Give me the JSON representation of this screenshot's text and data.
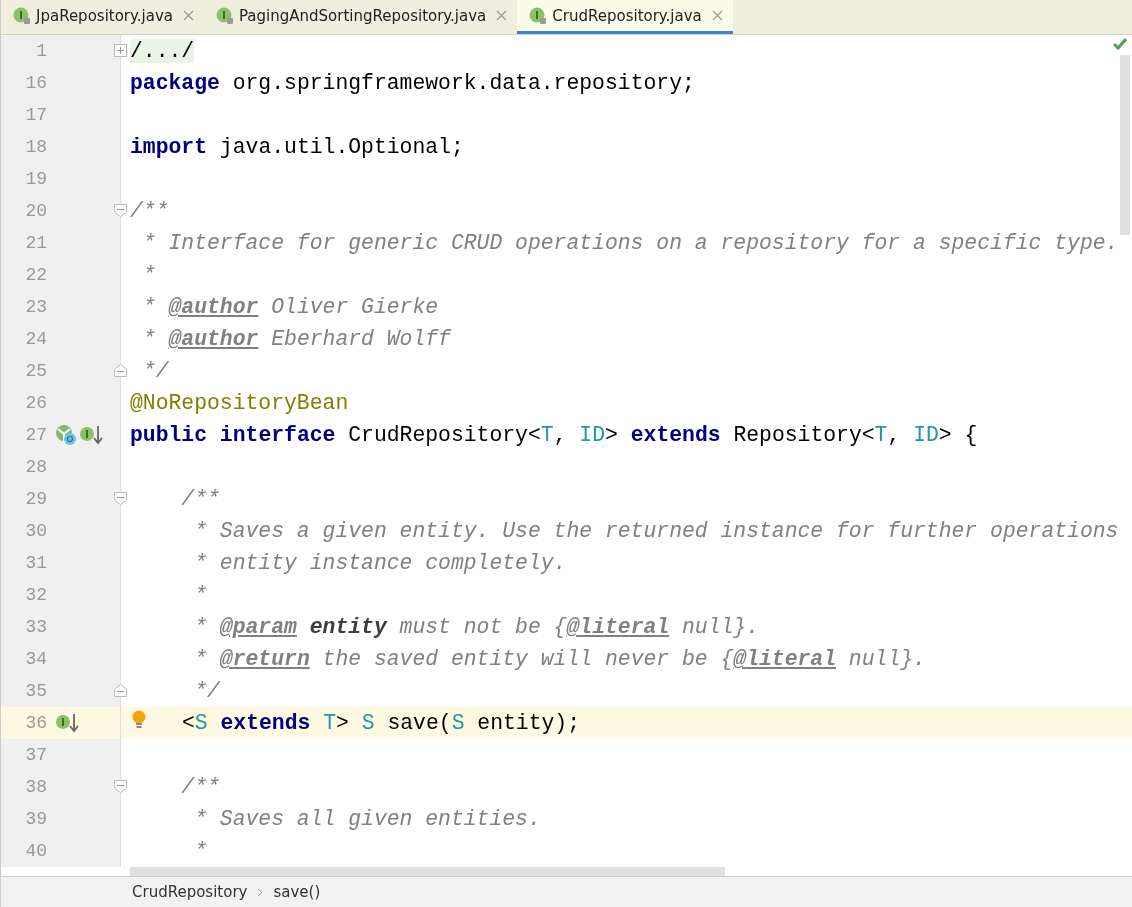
{
  "tabs": [
    {
      "label": "JpaRepository.java",
      "selected": false
    },
    {
      "label": "PagingAndSortingRepository.java",
      "selected": false
    },
    {
      "label": "CrudRepository.java",
      "selected": true
    }
  ],
  "lines": [
    {
      "number": "1",
      "current": false,
      "intention": false,
      "fold": {
        "kind": "expand"
      },
      "tokens": [
        {
          "kind": "folded",
          "text": "/.../"
        }
      ]
    },
    {
      "number": "16",
      "current": false,
      "intention": false,
      "tokens": [
        {
          "kind": "keyword",
          "text": "package"
        },
        {
          "kind": "plain",
          "text": " org.springframework.data.repository;"
        }
      ]
    },
    {
      "number": "17",
      "current": false,
      "intention": false
    },
    {
      "number": "18",
      "current": false,
      "intention": false,
      "tokens": [
        {
          "kind": "keyword",
          "text": "import"
        },
        {
          "kind": "plain",
          "text": " java.util.Optional;"
        }
      ]
    },
    {
      "number": "19",
      "current": false,
      "intention": false
    },
    {
      "number": "20",
      "current": false,
      "intention": false,
      "fold": {
        "kind": "start"
      },
      "tokens": [
        {
          "kind": "doc",
          "text": "/**"
        }
      ]
    },
    {
      "number": "21",
      "current": false,
      "intention": false,
      "tokens": [
        {
          "kind": "doc",
          "text": " * Interface for generic CRUD operations on a repository for a specific type."
        }
      ]
    },
    {
      "number": "22",
      "current": false,
      "intention": false,
      "tokens": [
        {
          "kind": "doc",
          "text": " *"
        }
      ]
    },
    {
      "number": "23",
      "current": false,
      "intention": false,
      "tokens": [
        {
          "kind": "doc",
          "text": " * "
        },
        {
          "kind": "doctag",
          "text": "@author"
        },
        {
          "kind": "doc",
          "text": " Oliver Gierke"
        }
      ]
    },
    {
      "number": "24",
      "current": false,
      "intention": false,
      "tokens": [
        {
          "kind": "doc",
          "text": " * "
        },
        {
          "kind": "doctag",
          "text": "@author"
        },
        {
          "kind": "doc",
          "text": " Eberhard Wolff"
        }
      ]
    },
    {
      "number": "25",
      "current": false,
      "intention": false,
      "fold": {
        "kind": "end"
      },
      "tokens": [
        {
          "kind": "doc",
          "text": " */"
        }
      ]
    },
    {
      "number": "26",
      "current": false,
      "intention": false,
      "tokens": [
        {
          "kind": "annotation",
          "text": "@NoRepositoryBean"
        }
      ]
    },
    {
      "number": "27",
      "current": false,
      "intention": false,
      "markers": [
        {
          "kind": "inheritors"
        },
        {
          "kind": "implements"
        }
      ],
      "tokens": [
        {
          "kind": "keyword",
          "text": "public"
        },
        {
          "kind": "keyword",
          "text": " interface"
        },
        {
          "kind": "plain",
          "text": " CrudRepository<"
        },
        {
          "kind": "typeparam",
          "text": "T"
        },
        {
          "kind": "plain",
          "text": ", "
        },
        {
          "kind": "typeparam",
          "text": "ID"
        },
        {
          "kind": "plain",
          "text": "> "
        },
        {
          "kind": "keyword",
          "text": "extends"
        },
        {
          "kind": "plain",
          "text": " Repository<"
        },
        {
          "kind": "typeparam",
          "text": "T"
        },
        {
          "kind": "plain",
          "text": ", "
        },
        {
          "kind": "typeparam",
          "text": "ID"
        },
        {
          "kind": "plain",
          "text": "> {"
        }
      ]
    },
    {
      "number": "28",
      "current": false,
      "intention": false
    },
    {
      "number": "29",
      "current": false,
      "intention": false,
      "fold": {
        "kind": "start"
      },
      "tokens": [
        {
          "kind": "doc",
          "text": "    /**"
        }
      ]
    },
    {
      "number": "30",
      "current": false,
      "intention": false,
      "tokens": [
        {
          "kind": "doc",
          "text": "     * Saves a given entity. Use the returned instance for further operations"
        }
      ]
    },
    {
      "number": "31",
      "current": false,
      "intention": false,
      "tokens": [
        {
          "kind": "doc",
          "text": "     * entity instance completely."
        }
      ]
    },
    {
      "number": "32",
      "current": false,
      "intention": false,
      "tokens": [
        {
          "kind": "doc",
          "text": "     *"
        }
      ]
    },
    {
      "number": "33",
      "current": false,
      "intention": false,
      "tokens": [
        {
          "kind": "doc",
          "text": "     * "
        },
        {
          "kind": "doctag",
          "text": "@param"
        },
        {
          "kind": "docbold",
          "text": " entity"
        },
        {
          "kind": "doc",
          "text": " must not be {"
        },
        {
          "kind": "doctag",
          "text": "@literal"
        },
        {
          "kind": "doc",
          "text": " null}."
        }
      ]
    },
    {
      "number": "34",
      "current": false,
      "intention": false,
      "tokens": [
        {
          "kind": "doc",
          "text": "     * "
        },
        {
          "kind": "doctag",
          "text": "@return"
        },
        {
          "kind": "doc",
          "text": " the saved entity will never be {"
        },
        {
          "kind": "doctag",
          "text": "@literal"
        },
        {
          "kind": "doc",
          "text": " null}."
        }
      ]
    },
    {
      "number": "35",
      "current": false,
      "intention": false,
      "fold": {
        "kind": "end"
      },
      "tokens": [
        {
          "kind": "doc",
          "text": "     */"
        }
      ]
    },
    {
      "number": "36",
      "current": true,
      "intention": true,
      "markers": [
        {
          "kind": "implements"
        }
      ],
      "tokens": [
        {
          "kind": "plain",
          "text": "<"
        },
        {
          "kind": "typeparam",
          "text": "S"
        },
        {
          "kind": "keyword",
          "text": " extends"
        },
        {
          "kind": "typeparam",
          "text": " T"
        },
        {
          "kind": "plain",
          "text": "> "
        },
        {
          "kind": "typeparam",
          "text": "S"
        },
        {
          "kind": "plain",
          "text": " save("
        },
        {
          "kind": "typeparam",
          "text": "S"
        },
        {
          "kind": "plain",
          "text": " entity);"
        }
      ]
    },
    {
      "number": "37",
      "current": false,
      "intention": false
    },
    {
      "number": "38",
      "current": false,
      "intention": false,
      "fold": {
        "kind": "start"
      },
      "tokens": [
        {
          "kind": "doc",
          "text": "    /**"
        }
      ]
    },
    {
      "number": "39",
      "current": false,
      "intention": false,
      "tokens": [
        {
          "kind": "doc",
          "text": "     * Saves all given entities."
        }
      ]
    },
    {
      "number": "40",
      "current": false,
      "intention": false,
      "tokens": [
        {
          "kind": "doc",
          "text": "     *"
        }
      ]
    }
  ],
  "breadcrumbs": [
    "CrudRepository",
    "save()"
  ]
}
